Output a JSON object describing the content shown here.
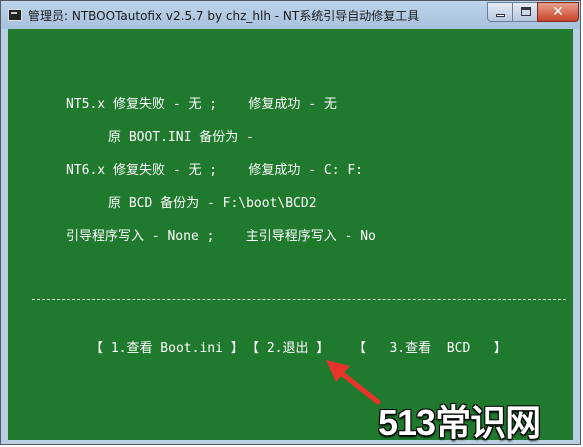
{
  "window": {
    "title": "管理员:  NTBOOTautofix v2.5.7 by chz_hlh - NT系统引导自动修复工具",
    "close_glyph": "✕",
    "icon": "console-icon"
  },
  "console": {
    "nt5_line": "NT5.x 修复失败 - 无 ;    修复成功 - 无",
    "nt5_backup": "原 BOOT.INI 备份为 -",
    "nt6_line": "NT6.x 修复失败 - 无 ;    修复成功 - C: F:",
    "nt6_backup": "原 BCD 备份为 - F:\\boot\\BCD2",
    "bootloader_line": "引导程序写入 - None ;    主引导程序写入 - No",
    "divider": "-----------------------------------------------------------------------------",
    "menu": {
      "item1": "【 1.查看 Boot.ini 】",
      "item2": "【 2.退出 】",
      "item3": "【   3.查看  BCD   】"
    }
  },
  "annotation": {
    "arrow_color": "#e8342a",
    "arrow_target": "menu-item-exit"
  },
  "watermark": "513常识网"
}
